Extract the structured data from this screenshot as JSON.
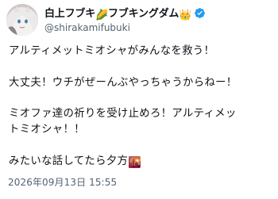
{
  "author": {
    "display_name": "白上フブキ",
    "name_emoji_corn": "🌽",
    "display_name_suffix": "フブキングダム",
    "name_emoji_crown": "👑",
    "handle": "@shirakamifubuki",
    "verified": true,
    "verified_color": "#1d9bf0"
  },
  "tweet": {
    "lines": [
      "アルティメットミオシャがみんなを救う！",
      "",
      "大丈夫！ウチがぜーんぶやっちゃうからねー！",
      "",
      "ミオファ達の祈りを受け止めろ！アルティメッ",
      "トミオシャ！！",
      "",
      "みたいな話してたら夕方"
    ],
    "trailing_emoji": "🌇"
  },
  "timestamp": "2026年09月13日 15:55"
}
